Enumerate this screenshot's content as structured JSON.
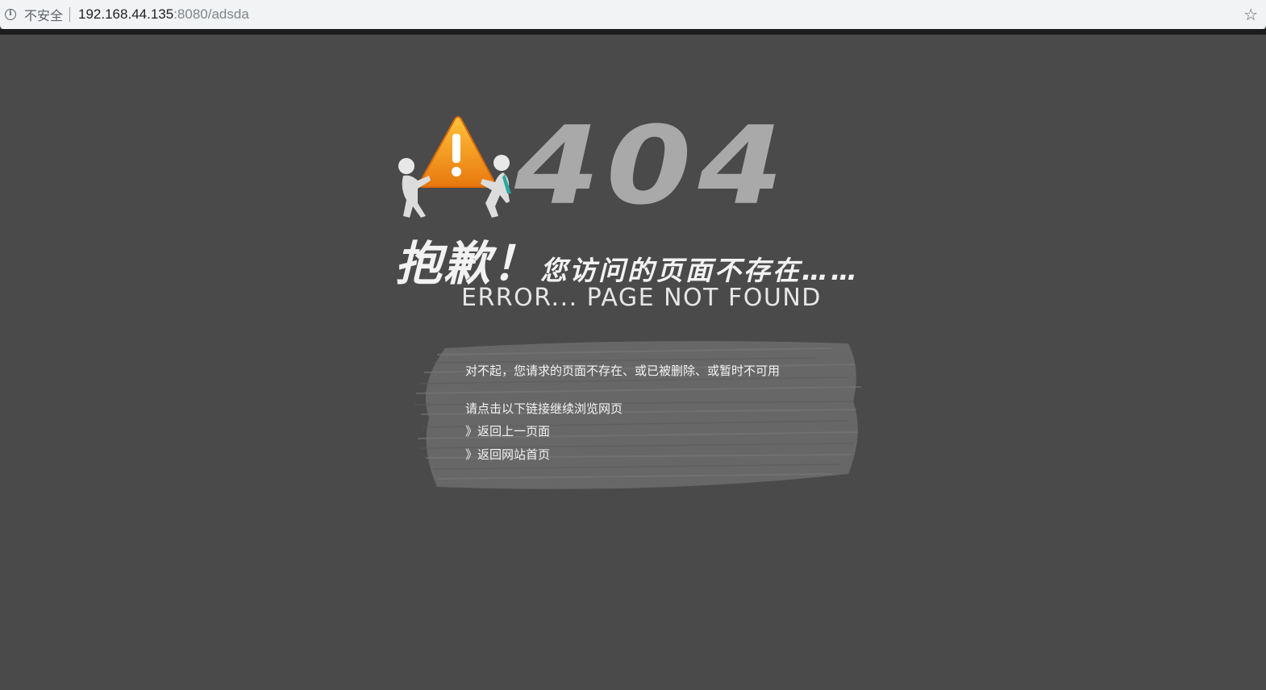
{
  "browser": {
    "security_label": "不安全",
    "url_host": "192.168.44.135",
    "url_rest": ":8080/adsda"
  },
  "error_page": {
    "code": "404",
    "sorry": "抱歉！",
    "headline_rest": "您访问的页面不存在……",
    "english": "ERROR... PAGE NOT FOUND",
    "message": "对不起，您请求的页面不存在、或已被删除、或暂时不可用",
    "prompt": "请点击以下链接继续浏览网页",
    "links": [
      {
        "label": "》返回上一页面"
      },
      {
        "label": "》返回网站首页"
      }
    ]
  },
  "icons": {
    "info": "info-icon",
    "star": "star-icon",
    "warning": "warning-triangle-icon"
  },
  "colors": {
    "background": "#4a4a4a",
    "warning_orange": "#f29a1e",
    "code_gray": "#a9a9a9"
  }
}
